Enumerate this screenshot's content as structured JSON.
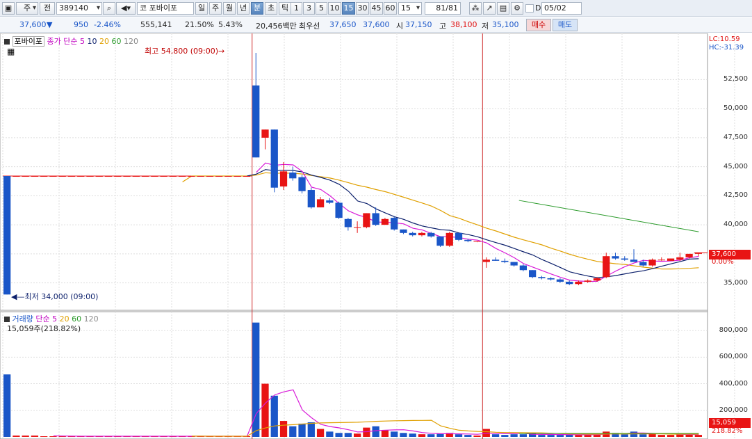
{
  "toolbar": {
    "market": "주",
    "prev_label": "전",
    "code": "389140",
    "stock_name": "포바이포",
    "name_prefix": "코",
    "periods": [
      "일",
      "주",
      "월",
      "년",
      "분",
      "초",
      "틱"
    ],
    "active_period": "분",
    "intervals": [
      "1",
      "3",
      "5",
      "10",
      "15",
      "30",
      "45",
      "60"
    ],
    "active_interval": "15",
    "interval_select": "15",
    "page_counter": "81",
    "page_total": "/81",
    "date_check_label": "D",
    "date_value": "05/02"
  },
  "quote": {
    "price": "37,600",
    "direction": "▼",
    "change": "950",
    "change_pct": "-2.46%",
    "volume": "555,141",
    "turnover_pct": "21.50%",
    "vol_ratio": "5.43%",
    "amount": "20,456백만",
    "best_label": "최우선",
    "best_ask": "37,650",
    "best_bid": "37,600",
    "open_label": "시",
    "open": "37,150",
    "high_label": "고",
    "high": "38,100",
    "low_label": "저",
    "low": "35,100",
    "buy_label": "매수",
    "sell_label": "매도"
  },
  "price_panel": {
    "stock_name": "포바이포",
    "legend_prefix": "종가 단순",
    "ma_periods": [
      "5",
      "10",
      "20",
      "60",
      "120"
    ],
    "lc_label": "LC:10.59",
    "hc_label": "HC:-31.39",
    "high_annotation": "최고 54,800 (09:00)",
    "low_annotation": "최저 34,000 (09:00)",
    "last_price_tag": "37,600",
    "last_pct_tag": "0.00%",
    "yaxis_ticks": [
      "52,500",
      "50,000",
      "47,500",
      "45,000",
      "42,500",
      "40,000",
      "35,000"
    ]
  },
  "volume_panel": {
    "legend_title": "거래량",
    "legend_prefix": "단순",
    "ma_periods": [
      "5",
      "20",
      "60",
      "120"
    ],
    "current": "15,059주(218.82%)",
    "yaxis_ticks": [
      "800,000",
      "600,000",
      "400,000",
      "200,000"
    ],
    "last_volume_tag": "15,059",
    "last_pct_tag": "218.82%"
  },
  "colors": {
    "up": "#e81414",
    "down": "#1a56c8",
    "ma5": "#d81ad8",
    "ma10": "#0b1f6b",
    "ma20": "#e0a000",
    "ma60": "#2a9a2a",
    "ma120": "#888888",
    "toolbar_bg": "#e9eef5"
  },
  "chart_data": {
    "type": "candlestick",
    "title": "",
    "ylim": [
      33000,
      56000
    ],
    "volume_ylim": [
      0,
      900000
    ],
    "candles": [
      {
        "o": 44200,
        "h": 44200,
        "l": 34000,
        "c": 34000,
        "v": 470000
      },
      {
        "o": 44200,
        "h": 44200,
        "l": 44200,
        "c": 44200,
        "v": 10000
      },
      {
        "o": 44200,
        "h": 44200,
        "l": 44200,
        "c": 44200,
        "v": 10000
      },
      {
        "o": 44200,
        "h": 44200,
        "l": 44200,
        "c": 44200,
        "v": 10000
      },
      {
        "o": 44200,
        "h": 44200,
        "l": 44200,
        "c": 44200,
        "v": 5000
      },
      {
        "o": 44200,
        "h": 44200,
        "l": 44200,
        "c": 44200,
        "v": 5000
      },
      {
        "o": 44200,
        "h": 44200,
        "l": 44200,
        "c": 44200,
        "v": 5000
      },
      {
        "o": 44200,
        "h": 44200,
        "l": 44200,
        "c": 44200,
        "v": 5000
      },
      {
        "o": 44200,
        "h": 44200,
        "l": 44200,
        "c": 44200,
        "v": 5000
      },
      {
        "o": 44200,
        "h": 44200,
        "l": 44200,
        "c": 44200,
        "v": 5000
      },
      {
        "o": 44200,
        "h": 44200,
        "l": 44200,
        "c": 44200,
        "v": 5000
      },
      {
        "o": 44200,
        "h": 44200,
        "l": 44200,
        "c": 44200,
        "v": 5000
      },
      {
        "o": 44200,
        "h": 44200,
        "l": 44200,
        "c": 44200,
        "v": 5000
      },
      {
        "o": 44200,
        "h": 44200,
        "l": 44200,
        "c": 44200,
        "v": 5000
      },
      {
        "o": 44200,
        "h": 44200,
        "l": 44200,
        "c": 44200,
        "v": 5000
      },
      {
        "o": 44200,
        "h": 44200,
        "l": 44200,
        "c": 44200,
        "v": 5000
      },
      {
        "o": 44200,
        "h": 44200,
        "l": 44200,
        "c": 44200,
        "v": 5000
      },
      {
        "o": 44200,
        "h": 44200,
        "l": 44200,
        "c": 44200,
        "v": 5000
      },
      {
        "o": 44200,
        "h": 44200,
        "l": 44200,
        "c": 44200,
        "v": 5000
      },
      {
        "o": 44200,
        "h": 44200,
        "l": 44200,
        "c": 44200,
        "v": 5000
      },
      {
        "o": 44200,
        "h": 44200,
        "l": 44200,
        "c": 44200,
        "v": 5000
      },
      {
        "o": 44200,
        "h": 44200,
        "l": 44200,
        "c": 44200,
        "v": 5000
      },
      {
        "o": 44200,
        "h": 44200,
        "l": 44200,
        "c": 44200,
        "v": 5000
      },
      {
        "o": 44200,
        "h": 44200,
        "l": 44200,
        "c": 44200,
        "v": 5000
      },
      {
        "o": 44200,
        "h": 44200,
        "l": 44200,
        "c": 44200,
        "v": 5000
      },
      {
        "o": 44200,
        "h": 44200,
        "l": 44200,
        "c": 44200,
        "v": 5000
      },
      {
        "o": 44200,
        "h": 44200,
        "l": 44200,
        "c": 44200,
        "v": 5000
      },
      {
        "o": 52000,
        "h": 54800,
        "l": 45800,
        "c": 45800,
        "v": 860000
      },
      {
        "o": 47500,
        "h": 48200,
        "l": 46500,
        "c": 48200,
        "v": 400000
      },
      {
        "o": 48200,
        "h": 48200,
        "l": 42800,
        "c": 43200,
        "v": 310000
      },
      {
        "o": 43300,
        "h": 45400,
        "l": 43000,
        "c": 44600,
        "v": 120000
      },
      {
        "o": 44500,
        "h": 45000,
        "l": 43800,
        "c": 44000,
        "v": 80000
      },
      {
        "o": 44100,
        "h": 44300,
        "l": 42700,
        "c": 42900,
        "v": 100000
      },
      {
        "o": 43000,
        "h": 43200,
        "l": 41400,
        "c": 41500,
        "v": 110000
      },
      {
        "o": 41500,
        "h": 42400,
        "l": 41500,
        "c": 42200,
        "v": 60000
      },
      {
        "o": 42100,
        "h": 42300,
        "l": 41800,
        "c": 41900,
        "v": 40000
      },
      {
        "o": 41900,
        "h": 42000,
        "l": 40500,
        "c": 40600,
        "v": 30000
      },
      {
        "o": 40500,
        "h": 40600,
        "l": 39500,
        "c": 39800,
        "v": 30000
      },
      {
        "o": 39800,
        "h": 40300,
        "l": 39300,
        "c": 39800,
        "v": 25000
      },
      {
        "o": 39800,
        "h": 41000,
        "l": 39700,
        "c": 41000,
        "v": 70000
      },
      {
        "o": 41000,
        "h": 41500,
        "l": 39900,
        "c": 40000,
        "v": 80000
      },
      {
        "o": 40000,
        "h": 40600,
        "l": 40000,
        "c": 40500,
        "v": 50000
      },
      {
        "o": 40600,
        "h": 40700,
        "l": 39500,
        "c": 39600,
        "v": 40000
      },
      {
        "o": 39600,
        "h": 39600,
        "l": 39200,
        "c": 39300,
        "v": 30000
      },
      {
        "o": 39300,
        "h": 39400,
        "l": 39000,
        "c": 39100,
        "v": 25000
      },
      {
        "o": 39100,
        "h": 39400,
        "l": 39000,
        "c": 39300,
        "v": 20000
      },
      {
        "o": 39300,
        "h": 39400,
        "l": 38900,
        "c": 39000,
        "v": 20000
      },
      {
        "o": 39000,
        "h": 39000,
        "l": 38100,
        "c": 38200,
        "v": 25000
      },
      {
        "o": 38200,
        "h": 39400,
        "l": 38100,
        "c": 39300,
        "v": 30000
      },
      {
        "o": 39300,
        "h": 39300,
        "l": 38600,
        "c": 38700,
        "v": 20000
      },
      {
        "o": 38700,
        "h": 38800,
        "l": 38500,
        "c": 38600,
        "v": 15000
      },
      {
        "o": 38600,
        "h": 38600,
        "l": 38500,
        "c": 38600,
        "v": 10000
      },
      {
        "o": 36800,
        "h": 37200,
        "l": 36300,
        "c": 37000,
        "v": 60000
      },
      {
        "o": 37000,
        "h": 37200,
        "l": 36900,
        "c": 36900,
        "v": 20000
      },
      {
        "o": 36900,
        "h": 37100,
        "l": 36700,
        "c": 36800,
        "v": 15000
      },
      {
        "o": 36800,
        "h": 36800,
        "l": 36400,
        "c": 36500,
        "v": 20000
      },
      {
        "o": 36500,
        "h": 36600,
        "l": 36000,
        "c": 36100,
        "v": 20000
      },
      {
        "o": 36100,
        "h": 36100,
        "l": 35400,
        "c": 35500,
        "v": 25000
      },
      {
        "o": 35500,
        "h": 35600,
        "l": 35300,
        "c": 35400,
        "v": 15000
      },
      {
        "o": 35400,
        "h": 35500,
        "l": 35200,
        "c": 35300,
        "v": 15000
      },
      {
        "o": 35300,
        "h": 35400,
        "l": 35000,
        "c": 35100,
        "v": 15000
      },
      {
        "o": 35100,
        "h": 35200,
        "l": 34800,
        "c": 34900,
        "v": 20000
      },
      {
        "o": 34900,
        "h": 35200,
        "l": 34800,
        "c": 35100,
        "v": 15000
      },
      {
        "o": 35100,
        "h": 35300,
        "l": 35000,
        "c": 35200,
        "v": 15000
      },
      {
        "o": 35200,
        "h": 35500,
        "l": 35100,
        "c": 35400,
        "v": 20000
      },
      {
        "o": 35500,
        "h": 37600,
        "l": 35400,
        "c": 37300,
        "v": 40000
      },
      {
        "o": 37300,
        "h": 37600,
        "l": 37000,
        "c": 37100,
        "v": 30000
      },
      {
        "o": 37100,
        "h": 37300,
        "l": 36900,
        "c": 37000,
        "v": 20000
      },
      {
        "o": 37000,
        "h": 37900,
        "l": 36900,
        "c": 36800,
        "v": 40000
      },
      {
        "o": 36800,
        "h": 37000,
        "l": 36400,
        "c": 36500,
        "v": 20000
      },
      {
        "o": 36500,
        "h": 37100,
        "l": 36400,
        "c": 37000,
        "v": 25000
      },
      {
        "o": 37000,
        "h": 37200,
        "l": 36900,
        "c": 37000,
        "v": 15000
      },
      {
        "o": 36900,
        "h": 37100,
        "l": 36900,
        "c": 37100,
        "v": 15000
      },
      {
        "o": 37000,
        "h": 37600,
        "l": 36900,
        "c": 37200,
        "v": 20000
      },
      {
        "o": 37200,
        "h": 37500,
        "l": 37100,
        "c": 37500,
        "v": 20000
      },
      {
        "o": 37500,
        "h": 37600,
        "l": 37300,
        "c": 37600,
        "v": 15059
      }
    ],
    "ma60_segment": {
      "from_index": 56,
      "from_value": 42100,
      "to_value": 39400
    },
    "current_price": 37600
  }
}
